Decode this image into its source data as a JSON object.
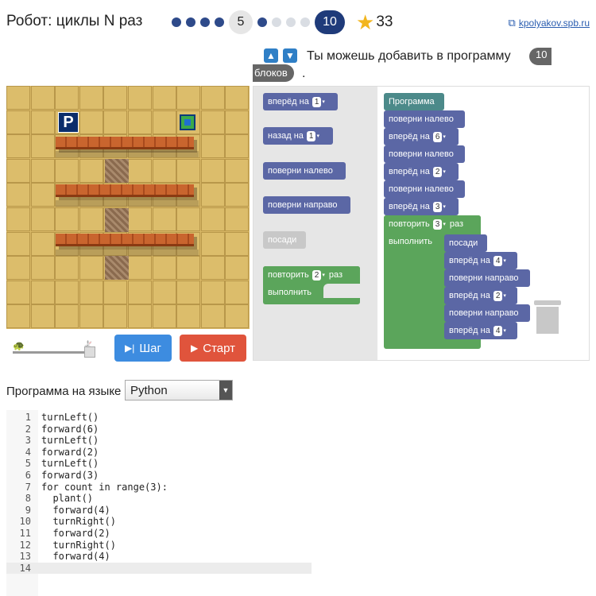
{
  "header": {
    "title": "Робот: циклы N раз",
    "current_level": "5",
    "target_level": "10",
    "score": "33",
    "site_link": "kpolyakov.spb.ru"
  },
  "toolbar": {
    "message": "Ты можешь добавить в программу",
    "limit_number": "10",
    "limit_word": "блоков",
    "end": "."
  },
  "controls": {
    "step_label": "Шаг",
    "start_label": "Старт"
  },
  "toolbox": {
    "forward": "вперёд на",
    "forward_value": "1",
    "back": "назад на",
    "back_value": "1",
    "turn_left": "поверни налево",
    "turn_right": "поверни направо",
    "plant": "посади",
    "repeat": "повторить",
    "repeat_value": "2",
    "repeat_unit": "раз",
    "do": "выполнить"
  },
  "program": {
    "header": "Программа",
    "b1": "поверни налево",
    "b2": "вперёд на",
    "b2v": "6",
    "b3": "поверни налево",
    "b4": "вперёд на",
    "b4v": "2",
    "b5": "поверни налево",
    "b6": "вперёд на",
    "b6v": "3",
    "loop": "повторить",
    "loopv": "3",
    "loopu": "раз",
    "do": "выполнить",
    "i1": "посади",
    "i2": "вперёд на",
    "i2v": "4",
    "i3": "поверни направо",
    "i4": "вперёд на",
    "i4v": "2",
    "i5": "поверни направо",
    "i6": "вперёд на",
    "i6v": "4"
  },
  "language": {
    "label": "Программа на языке",
    "selected": "Python"
  },
  "code_lines": [
    "turnLeft()",
    "forward(6)",
    "turnLeft()",
    "forward(2)",
    "turnLeft()",
    "forward(3)",
    "for count in range(3):",
    "  plant()",
    "  forward(4)",
    "  turnRight()",
    "  forward(2)",
    "  turnRight()",
    "  forward(4)",
    ""
  ],
  "line_numbers": [
    "1",
    "2",
    "3",
    "4",
    "5",
    "6",
    "7",
    "8",
    "9",
    "10",
    "11",
    "12",
    "13",
    "14"
  ],
  "colors": {
    "accent": "#1f3b7a",
    "step_button": "#3d8ce0",
    "start_button": "#e0543c",
    "motion_block": "#5b67a5",
    "loop_block": "#5ba55b"
  }
}
